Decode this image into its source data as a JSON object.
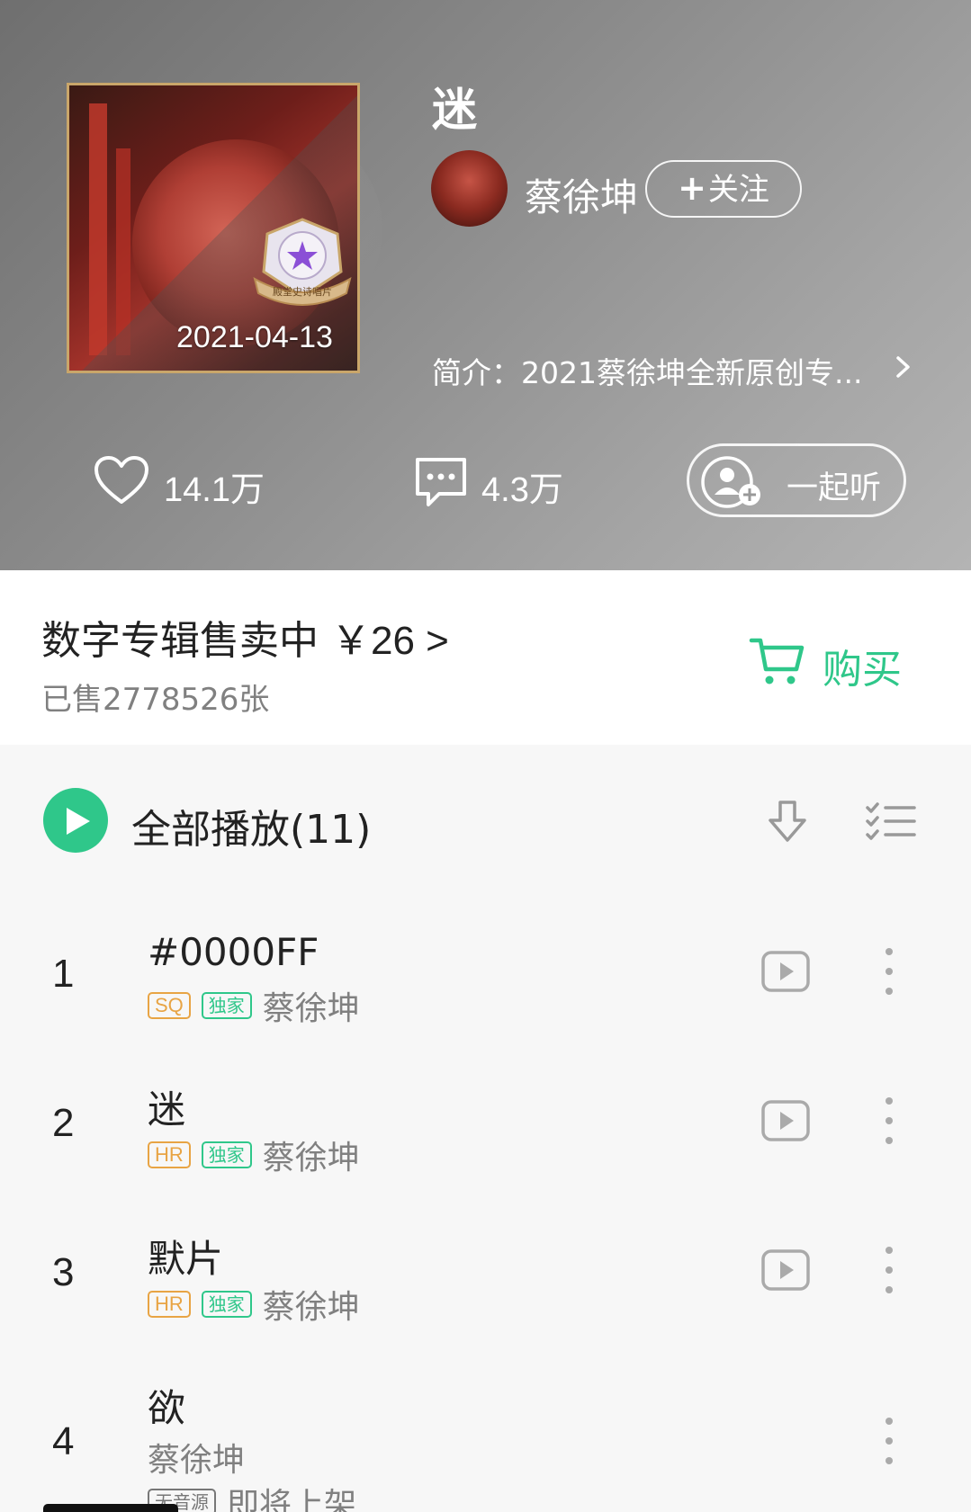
{
  "album": {
    "title": "迷",
    "release_date": "2021-04-13",
    "badge_text": "殿堂史诗唱片",
    "artist": "蔡徐坤",
    "follow_label": "关注",
    "follow_plus": "+",
    "intro": "简介：2021蔡徐坤全新原创专...",
    "likes": "14.1万",
    "comments": "4.3万",
    "listen_together": "一起听"
  },
  "purchase": {
    "title": "数字专辑售卖中",
    "price": "￥26 >",
    "sold": "已售2778526张",
    "buy_label": "购买"
  },
  "playlist": {
    "play_all": "全部播放(11)",
    "tracks": [
      {
        "num": "1",
        "title": "#0000FF",
        "quality": "SQ",
        "exclusive": "独家",
        "artist": "蔡徐坤"
      },
      {
        "num": "2",
        "title": "迷",
        "quality": "HR",
        "exclusive": "独家",
        "artist": "蔡徐坤"
      },
      {
        "num": "3",
        "title": "默片",
        "quality": "HR",
        "exclusive": "独家",
        "artist": "蔡徐坤"
      },
      {
        "num": "4",
        "title": "欲",
        "artist": "蔡徐坤",
        "no_source": "无音源",
        "status": "即将上架"
      }
    ]
  },
  "colors": {
    "accent": "#2fc78a",
    "quality_tag": "#e8a444",
    "muted": "#808080"
  },
  "icons": [
    "heart-icon",
    "comment-icon",
    "listen-together-icon",
    "cart-icon",
    "play-icon",
    "download-icon",
    "multi-select-icon",
    "mv-icon",
    "more-icon",
    "chevron-right-icon"
  ]
}
